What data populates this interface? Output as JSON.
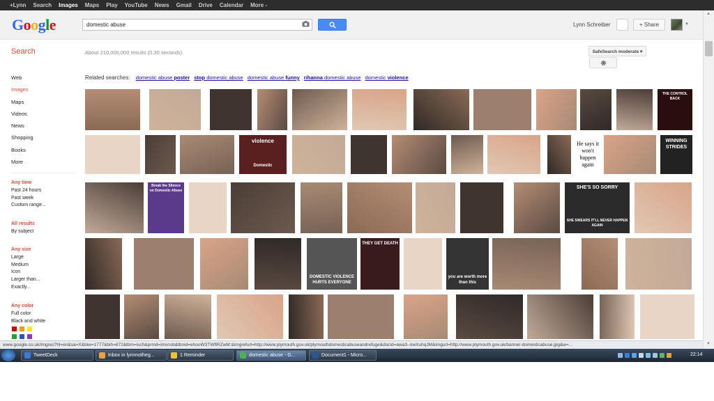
{
  "topbar": {
    "links": [
      {
        "label": "+Lynn",
        "active": false
      },
      {
        "label": "Search",
        "active": false
      },
      {
        "label": "Images",
        "active": true
      },
      {
        "label": "Maps",
        "active": false
      },
      {
        "label": "Play",
        "active": false
      },
      {
        "label": "YouTube",
        "active": false
      },
      {
        "label": "News",
        "active": false
      },
      {
        "label": "Gmail",
        "active": false
      },
      {
        "label": "Drive",
        "active": false
      },
      {
        "label": "Calendar",
        "active": false
      },
      {
        "label": "More -",
        "active": false
      }
    ]
  },
  "header": {
    "logo_letters": [
      "G",
      "o",
      "o",
      "g",
      "l",
      "e"
    ],
    "query": "domestic abuse",
    "user_name": "Lynn Schreiber",
    "share_label": "+ Share",
    "camera_icon": "camera-icon",
    "search_icon": "magnifier-icon"
  },
  "subheader": {
    "title": "Search",
    "results": "About 210,000,000 results (0.30 seconds)",
    "safesearch": "SafeSearch moderate ▾",
    "gear_icon": "gear-icon"
  },
  "leftnav": {
    "items": [
      {
        "label": "Web",
        "selected": false
      },
      {
        "label": "Images",
        "selected": true
      },
      {
        "label": "Maps",
        "selected": false
      },
      {
        "label": "Videos",
        "selected": false
      },
      {
        "label": "News",
        "selected": false
      },
      {
        "label": "Shopping",
        "selected": false
      },
      {
        "label": "Books",
        "selected": false
      },
      {
        "label": "More",
        "selected": false
      }
    ],
    "any_time": {
      "heading": "Any time",
      "options": [
        "Past 24 hours",
        "Past week",
        "Custom range..."
      ]
    },
    "all_results": {
      "heading": "All results",
      "options": [
        "By subject"
      ]
    },
    "any_size": {
      "heading": "Any size",
      "options": [
        "Large",
        "Medium",
        "Icon",
        "Larger than...",
        "Exactly..."
      ]
    },
    "any_color": {
      "heading": "Any color",
      "options": [
        "Full color",
        "Black and white"
      ]
    },
    "color_swatches": [
      "#cc0000",
      "#f09a1c",
      "#f5e62e",
      "#2e9e2e",
      "#2f53c7",
      "#8a3cb5"
    ]
  },
  "related": {
    "prefix": "Related searches:",
    "links": [
      {
        "plain": "domestic abuse ",
        "bold": "poster",
        "bold_first": false
      },
      {
        "plain": " domestic abuse",
        "bold": "stop",
        "bold_first": true
      },
      {
        "plain": "domestic abuse ",
        "bold": "funny",
        "bold_first": false
      },
      {
        "plain": " domestic abuse",
        "bold": "rihanna",
        "bold_first": true
      },
      {
        "plain": "domestic ",
        "bold": "violence",
        "bold_first": false
      }
    ]
  },
  "image_captions": [
    {
      "text": "He says it won't happen again"
    },
    {
      "text": "Break the Silence on Domestic Abuse"
    },
    {
      "text": "SHE'S SO SORRY"
    },
    {
      "text": "SHE SWEARS IT'LL NEVER HAPPEN AGAIN"
    },
    {
      "text": "DOMESTIC VIOLENCE HURTS EVERYONE"
    },
    {
      "text": "THEY GET DEATH"
    },
    {
      "text": "you are worth more than this"
    },
    {
      "text": "WINNING STRIDES"
    },
    {
      "text": "violence"
    },
    {
      "text": "Domestic"
    },
    {
      "text": "THE CONTROL BACK"
    }
  ],
  "statusbar": {
    "url": "www.google.co.uk/imgres?hl=en&sa=X&biw=1777&bih=872&tbm=isch&prmd=imvnsb&tbnid=ehooW3TWfIRZwM:&imgrefurl=http://www.plymouth.gov.uk/plymouthdomesticabuseandrefuge&docid=awa3--kwXuhqJM&imgurl=http://www.plymouth.gov.uk/banner-domesticabuse.jpg&w=..."
  },
  "taskbar": {
    "tasks": [
      {
        "label": "TweetDeck",
        "active": false,
        "color": "#3a7bd5"
      },
      {
        "label": "Inbox in lynnnotheg...",
        "active": false,
        "color": "#e8a33c"
      },
      {
        "label": "1 Reminder",
        "active": false,
        "color": "#f1c232"
      },
      {
        "label": "domestic abuse - G...",
        "active": true,
        "color": "#4caf50"
      },
      {
        "label": "Document1 - Micro...",
        "active": false,
        "color": "#2b5797"
      }
    ],
    "clock": "22:14"
  },
  "colors": {
    "accent_red": "#dd4b39",
    "link_blue": "#1a0dab",
    "search_blue": "#4a8af4"
  }
}
